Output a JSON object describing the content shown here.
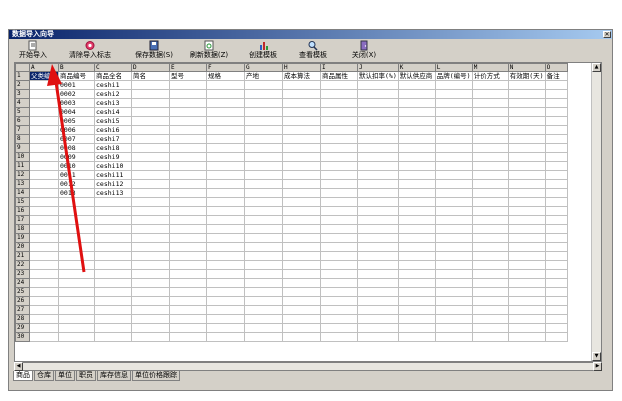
{
  "window": {
    "title": "数据导入向导"
  },
  "toolbar": {
    "buttons": [
      {
        "label": "开始导入",
        "icon": "import-icon"
      },
      {
        "label": "清除导入标志",
        "icon": "clear-icon"
      },
      {
        "label": "保存数据(S)",
        "icon": "save-icon"
      },
      {
        "label": "刷新数据(Z)",
        "icon": "refresh-icon"
      },
      {
        "label": "创建模板",
        "icon": "chart-icon"
      },
      {
        "label": "查看模板",
        "icon": "search-icon"
      },
      {
        "label": "关闭(X)",
        "icon": "close-door-icon"
      }
    ]
  },
  "grid": {
    "col_letters": [
      "A",
      "B",
      "C",
      "D",
      "E",
      "F",
      "G",
      "H",
      "I",
      "J",
      "K",
      "L",
      "M",
      "N",
      "O"
    ],
    "headers": [
      "父类编号",
      "商品编号",
      "商品全名",
      "简名",
      "型号",
      "规格",
      "产地",
      "成本算法",
      "商品属性",
      "默认扣率(%)",
      "默认供应商",
      "品牌(编号)",
      "计价方式",
      "有效期(天)",
      "备注"
    ],
    "rows": [
      [
        "",
        "0001",
        "ceshi1"
      ],
      [
        "",
        "0002",
        "ceshi2"
      ],
      [
        "",
        "0003",
        "ceshi3"
      ],
      [
        "",
        "0004",
        "ceshi4"
      ],
      [
        "",
        "0005",
        "ceshi5"
      ],
      [
        "",
        "0006",
        "ceshi6"
      ],
      [
        "",
        "0007",
        "ceshi7"
      ],
      [
        "",
        "0008",
        "ceshi8"
      ],
      [
        "",
        "0009",
        "ceshi9"
      ],
      [
        "",
        "0010",
        "ceshi10"
      ],
      [
        "",
        "0011",
        "ceshi11"
      ],
      [
        "",
        "0012",
        "ceshi12"
      ],
      [
        "",
        "0013",
        "ceshi13"
      ]
    ],
    "total_rows": 30
  },
  "tabs": [
    {
      "label": "商品",
      "active": true
    },
    {
      "label": "仓库"
    },
    {
      "label": "单位"
    },
    {
      "label": "职员"
    },
    {
      "label": "库存信息"
    },
    {
      "label": "单位价格跟踪"
    }
  ]
}
